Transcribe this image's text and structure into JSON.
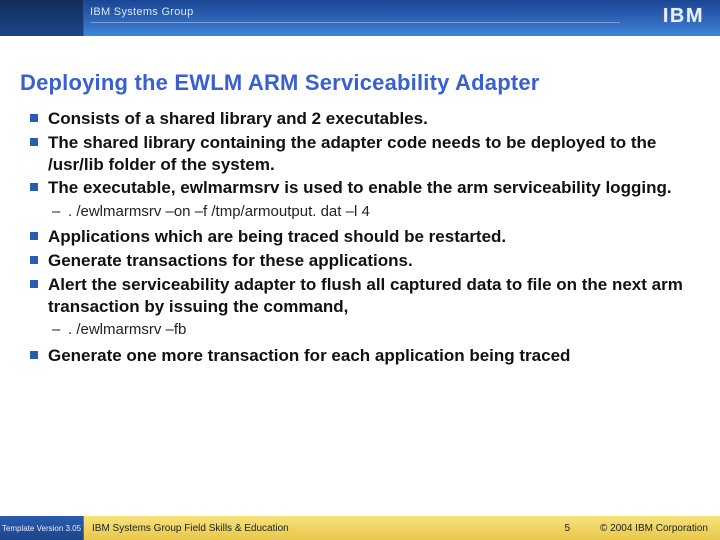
{
  "header": {
    "group": "IBM Systems Group",
    "logo": "IBM"
  },
  "title": "Deploying the EWLM ARM Serviceability Adapter",
  "bullets": {
    "b0": "Consists of a shared library and 2 executables.",
    "b1": "The shared library containing the adapter code needs to be deployed to the /usr/lib folder of the system.",
    "b2": "The executable, ewlmarmsrv is used to enable the arm serviceability logging.",
    "b2_sub0": ". /ewlmarmsrv –on –f /tmp/armoutput. dat –l 4",
    "b3": "Applications which are being traced should be restarted.",
    "b4": "Generate transactions for these applications.",
    "b5": "Alert the serviceability adapter to flush all captured data to file on the next arm transaction by issuing the command,",
    "b5_sub0": ". /ewlmarmsrv –fb",
    "b6": "Generate one more transaction for each application being traced"
  },
  "footer": {
    "template_version": "Template Version 3.05",
    "branch": "IBM Systems Group Field Skills & Education",
    "page": "5",
    "copyright": "© 2004 IBM Corporation"
  }
}
